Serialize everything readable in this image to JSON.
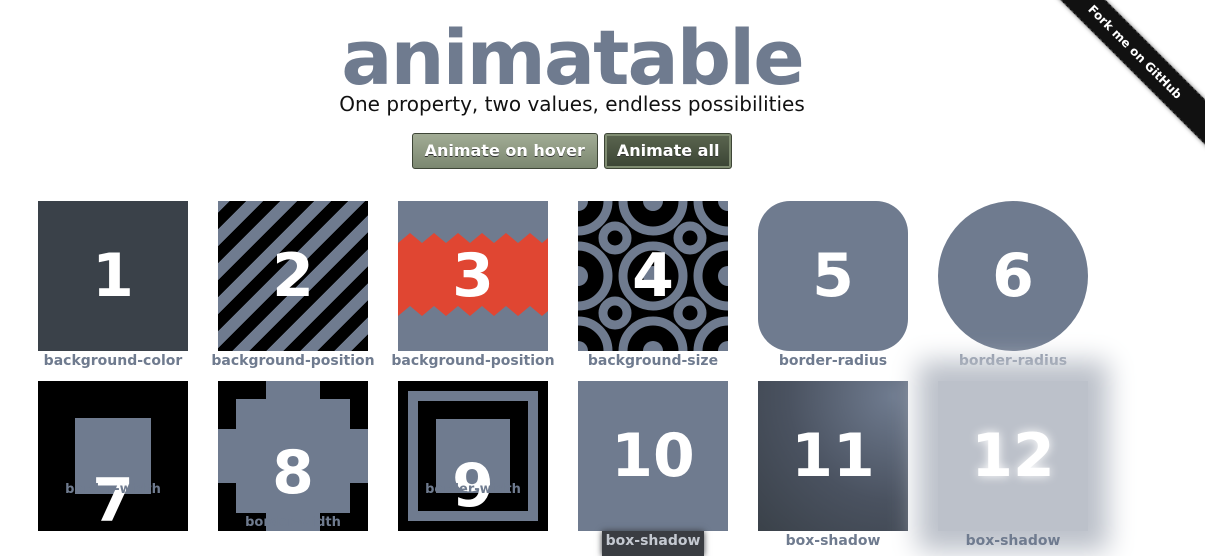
{
  "header": {
    "title": "animatable",
    "subtitle": "One property, two values, endless possibilities"
  },
  "buttons": {
    "hover_label": "Animate on hover",
    "all_label": "Animate all"
  },
  "ribbon": {
    "label": "Fork me on GitHub"
  },
  "tiles": [
    {
      "number": "1",
      "property": "background-color"
    },
    {
      "number": "2",
      "property": "background-position"
    },
    {
      "number": "3",
      "property": "background-position"
    },
    {
      "number": "4",
      "property": "background-size"
    },
    {
      "number": "5",
      "property": "border-radius"
    },
    {
      "number": "6",
      "property": "border-radius"
    },
    {
      "number": "7",
      "property": "border-width"
    },
    {
      "number": "8",
      "property": "border-width"
    },
    {
      "number": "9",
      "property": "border-width"
    },
    {
      "number": "10",
      "property": "box-shadow"
    },
    {
      "number": "11",
      "property": "box-shadow"
    },
    {
      "number": "12",
      "property": "box-shadow"
    }
  ],
  "colors": {
    "slate": "#6f7b8f",
    "dark": "#3a4149",
    "red": "#e04632",
    "button_green": "#7b8770"
  }
}
